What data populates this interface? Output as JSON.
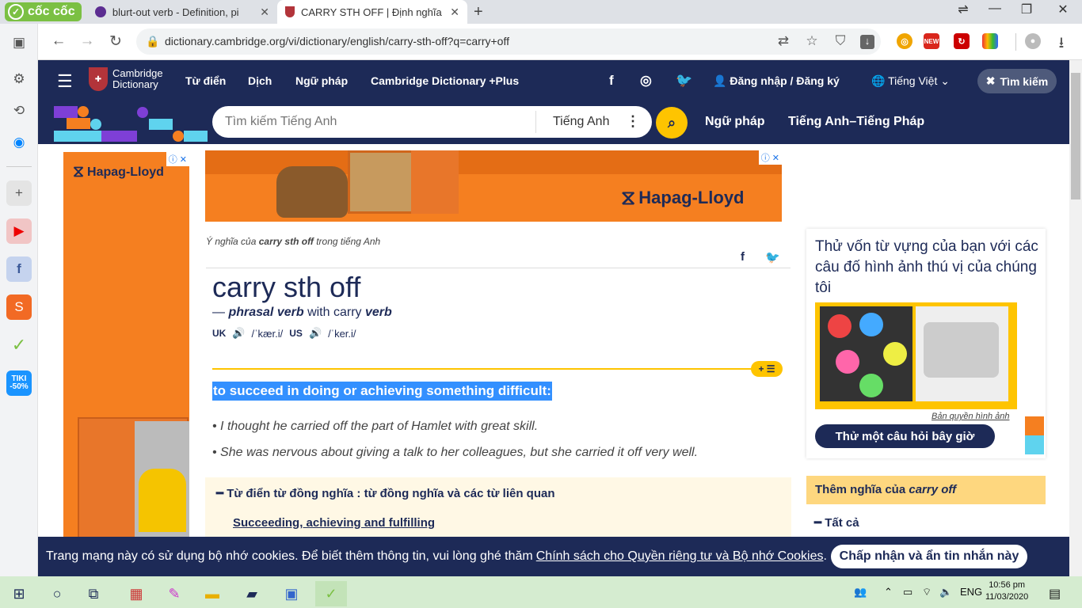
{
  "browser": {
    "brand": "cốc cốc",
    "tabs": [
      {
        "title": "blurt-out verb - Definition, pi"
      },
      {
        "title": "CARRY STH OFF | Định nghĩa"
      }
    ],
    "url": "dictionary.cambridge.org/vi/dictionary/english/carry-sth-off?q=carry+off",
    "ext_new_badge": "NEW"
  },
  "site": {
    "logo_line1": "Cambridge",
    "logo_line2": "Dictionary",
    "nav": [
      "Từ điển",
      "Dịch",
      "Ngữ pháp",
      "Cambridge Dictionary +Plus"
    ],
    "login": "Đăng nhập / Đăng ký",
    "language": "Tiếng Việt",
    "search_toggle": "Tìm kiếm",
    "search_placeholder": "Tìm kiếm Tiếng Anh",
    "search_lang": "Tiếng Anh",
    "band_links": [
      "Ngữ pháp",
      "Tiếng Anh–Tiếng Pháp"
    ]
  },
  "ads": {
    "brand": "Hapag-Lloyd"
  },
  "entry": {
    "meaning_prefix": "Ý nghĩa của",
    "meaning_word": "carry sth off",
    "meaning_suffix": "trong tiếng Anh",
    "headword": "carry sth off",
    "pos_dash": "—",
    "pos": "phrasal verb",
    "pos_with": "with carry",
    "pos_verb": "verb",
    "uk_label": "UK",
    "uk_ipa": "/ˈkær.i/",
    "us_label": "US",
    "us_ipa": "/ˈker.i/",
    "definition": "to succeed in doing or achieving something difficult:",
    "examples": [
      "I thought he carried off the part of Hamlet with great skill.",
      "She was nervous about giving a talk to her colleagues, but she carried it off very well."
    ],
    "thesaurus_title": "Từ điển từ đồng nghĩa : từ đồng nghĩa và các từ liên quan",
    "thesaurus_link": "Succeeding, achieving and fulfilling"
  },
  "sidebar_right": {
    "quiz_title": "Thử vốn từ vựng của bạn với các câu đố hình ảnh thú vị của chúng tôi",
    "credit": "Bản quyền hình ảnh",
    "quiz_button": "Thử một câu hỏi bây giờ",
    "more_prefix": "Thêm nghĩa của",
    "more_word": "carry off",
    "all": "Tất cả"
  },
  "cookie": {
    "text": "Trang mạng này có sử dụng bộ nhớ cookies. Để biết thêm thông tin, vui lòng ghé thăm",
    "link": "Chính sách cho Quyền riêng tư và Bộ nhớ Cookies",
    "end": ".",
    "button": "Chấp nhận và ẩn tin nhắn này"
  },
  "taskbar": {
    "lang": "ENG",
    "time": "10:56 pm",
    "date": "11/03/2020",
    "tiki_line1": "TIKI",
    "tiki_line2": "-50%"
  },
  "colors": {
    "navy": "#1d2a57",
    "yellow": "#fec400",
    "orange": "#f57f20",
    "highlight": "#3390ff"
  }
}
